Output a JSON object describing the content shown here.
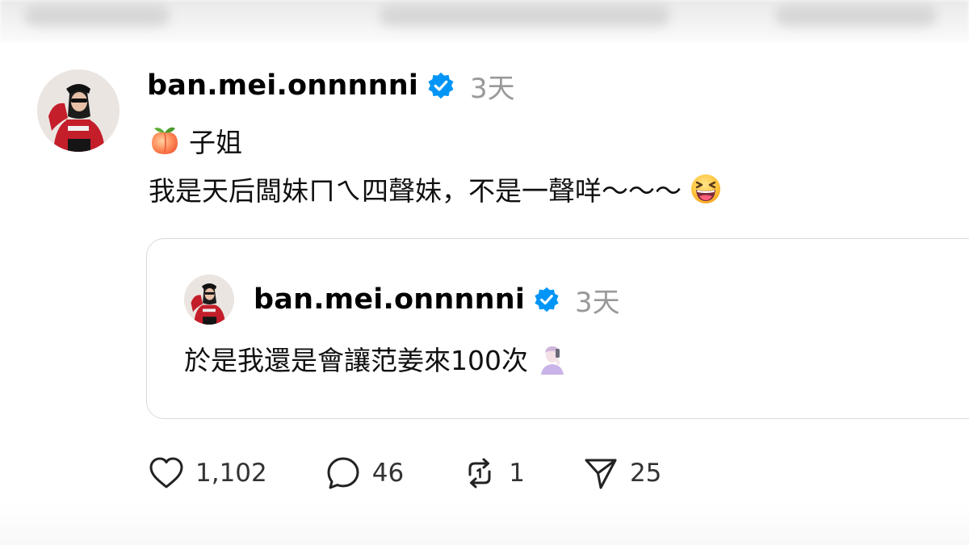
{
  "post": {
    "username": "ban.mei.onnnnni",
    "verified_icon": "verified-badge-icon",
    "timestamp": "3天",
    "line1_emoji": "peach-emoji",
    "line1_text": "子姐",
    "line2_text": "我是天后闆妹ㄇㄟ四聲妹，不是一聲咩～～～",
    "line2_emoji": "laughing-emoji"
  },
  "quoted_post": {
    "username": "ban.mei.onnnnni",
    "timestamp": "3天",
    "text": "於是我還是會讓范姜來100次",
    "emoji": "person-with-phone-emoji"
  },
  "actions": {
    "like": {
      "icon": "heart-icon",
      "count": "1,102"
    },
    "reply": {
      "icon": "comment-icon",
      "count": "46"
    },
    "repost": {
      "icon": "repost-icon",
      "count": "1"
    },
    "share": {
      "icon": "send-icon",
      "count": "25"
    }
  },
  "colors": {
    "verified_blue": "#0095f6",
    "timestamp_gray": "#999999",
    "card_border": "#d9d9d9",
    "avatar_red": "#c41e2a"
  }
}
